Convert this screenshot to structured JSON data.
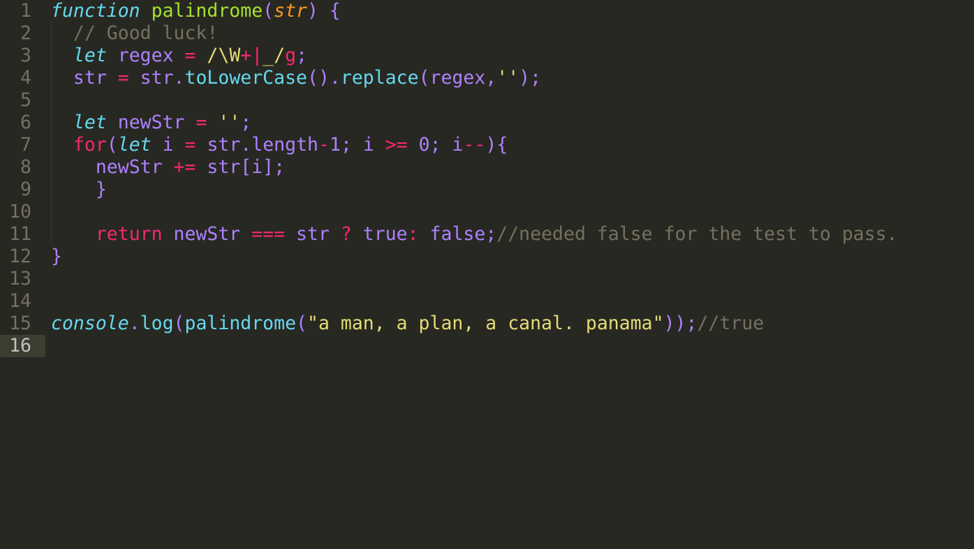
{
  "editor": {
    "line_numbers": [
      "1",
      "2",
      "3",
      "4",
      "5",
      "6",
      "7",
      "8",
      "9",
      "10",
      "11",
      "12",
      "13",
      "14",
      "15",
      "16"
    ],
    "active_line": "16",
    "colors": {
      "background": "#272822",
      "keyword": "#66d9ef",
      "function_name": "#a6e22e",
      "parameter": "#fd971f",
      "operator": "#f92672",
      "identifier": "#ae81ff",
      "string": "#e6db74",
      "comment": "#75715e"
    },
    "lines": [
      [
        {
          "t": "function",
          "c": "kw"
        },
        {
          "t": " ",
          "c": "p"
        },
        {
          "t": "palindrome",
          "c": "fn"
        },
        {
          "t": "(",
          "c": "p"
        },
        {
          "t": "str",
          "c": "param"
        },
        {
          "t": ") {",
          "c": "p"
        }
      ],
      [
        {
          "t": "  ",
          "c": "p"
        },
        {
          "t": "// Good luck!",
          "c": "cm"
        }
      ],
      [
        {
          "t": "  ",
          "c": "p"
        },
        {
          "t": "let",
          "c": "kw"
        },
        {
          "t": " regex ",
          "c": "id"
        },
        {
          "t": "=",
          "c": "op"
        },
        {
          "t": " ",
          "c": "p"
        },
        {
          "t": "/\\W",
          "c": "rx"
        },
        {
          "t": "+|",
          "c": "op"
        },
        {
          "t": "_/",
          "c": "rx"
        },
        {
          "t": "g",
          "c": "op"
        },
        {
          "t": ";",
          "c": "p"
        }
      ],
      [
        {
          "t": "  ",
          "c": "p"
        },
        {
          "t": "str ",
          "c": "id"
        },
        {
          "t": "=",
          "c": "op"
        },
        {
          "t": " str.",
          "c": "id"
        },
        {
          "t": "toLowerCase",
          "c": "meth"
        },
        {
          "t": "().",
          "c": "p"
        },
        {
          "t": "replace",
          "c": "meth"
        },
        {
          "t": "(regex,",
          "c": "p"
        },
        {
          "t": "''",
          "c": "str"
        },
        {
          "t": ");",
          "c": "p"
        }
      ],
      [],
      [
        {
          "t": "  ",
          "c": "p"
        },
        {
          "t": "let",
          "c": "kw"
        },
        {
          "t": " newStr ",
          "c": "id"
        },
        {
          "t": "=",
          "c": "op"
        },
        {
          "t": " ",
          "c": "p"
        },
        {
          "t": "''",
          "c": "str"
        },
        {
          "t": ";",
          "c": "p"
        }
      ],
      [
        {
          "t": "  ",
          "c": "p"
        },
        {
          "t": "for",
          "c": "ctl"
        },
        {
          "t": "(",
          "c": "p"
        },
        {
          "t": "let",
          "c": "kw"
        },
        {
          "t": " i ",
          "c": "id"
        },
        {
          "t": "=",
          "c": "op"
        },
        {
          "t": " str.",
          "c": "id"
        },
        {
          "t": "length",
          "c": "id"
        },
        {
          "t": "-",
          "c": "op"
        },
        {
          "t": "1",
          "c": "num"
        },
        {
          "t": "; i ",
          "c": "id"
        },
        {
          "t": ">=",
          "c": "op"
        },
        {
          "t": " ",
          "c": "p"
        },
        {
          "t": "0",
          "c": "num"
        },
        {
          "t": "; i",
          "c": "id"
        },
        {
          "t": "--",
          "c": "op"
        },
        {
          "t": "){",
          "c": "p"
        }
      ],
      [
        {
          "t": "    ",
          "c": "p"
        },
        {
          "t": "newStr ",
          "c": "id"
        },
        {
          "t": "+=",
          "c": "op"
        },
        {
          "t": " str[i];",
          "c": "id"
        }
      ],
      [
        {
          "t": "    }",
          "c": "p"
        }
      ],
      [],
      [
        {
          "t": "    ",
          "c": "p"
        },
        {
          "t": "return",
          "c": "ctl"
        },
        {
          "t": " newStr ",
          "c": "id"
        },
        {
          "t": "===",
          "c": "op"
        },
        {
          "t": " str ",
          "c": "id"
        },
        {
          "t": "?",
          "c": "op"
        },
        {
          "t": " true",
          "c": "id"
        },
        {
          "t": ":",
          "c": "op"
        },
        {
          "t": " false;",
          "c": "id"
        },
        {
          "t": "//needed false for the test to pass.",
          "c": "cm"
        }
      ],
      [
        {
          "t": "}",
          "c": "p"
        }
      ],
      [],
      [],
      [
        {
          "t": "console",
          "c": "bi"
        },
        {
          "t": ".",
          "c": "p"
        },
        {
          "t": "log",
          "c": "meth"
        },
        {
          "t": "(",
          "c": "p"
        },
        {
          "t": "palindrome",
          "c": "meth"
        },
        {
          "t": "(",
          "c": "p"
        },
        {
          "t": "\"a man, a plan, a canal. panama\"",
          "c": "str"
        },
        {
          "t": "));",
          "c": "p"
        },
        {
          "t": "//true",
          "c": "cm"
        }
      ],
      []
    ]
  }
}
